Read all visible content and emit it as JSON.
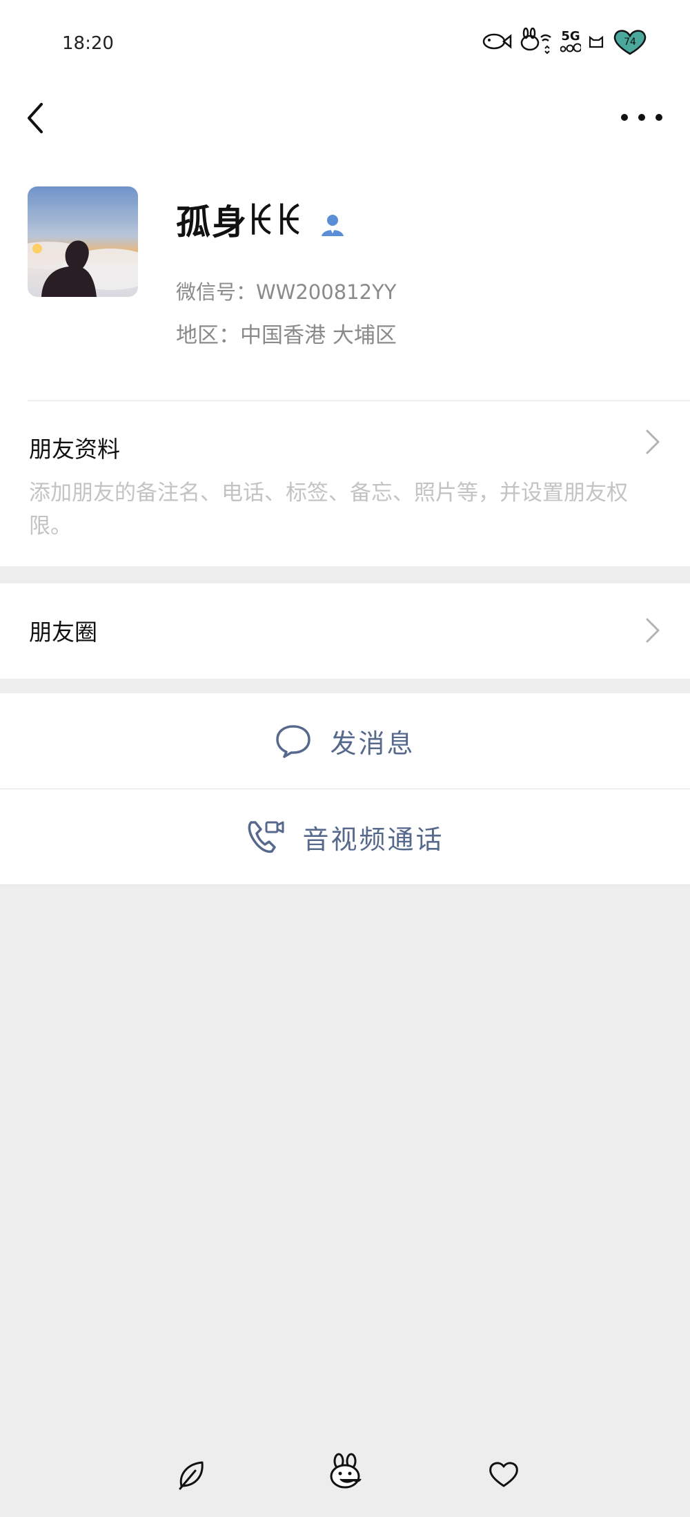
{
  "status_bar": {
    "time": "18:20",
    "network": "5G",
    "battery": "74"
  },
  "header": {
    "back_icon": "chevron-left-icon",
    "more_icon": "more-dots-icon"
  },
  "profile": {
    "nickname": "孤身ꀘꀘ",
    "wechat_id": "微信号：WW200812YY",
    "region": "地区：中国香港 大埔区",
    "badge_icon": "person-icon"
  },
  "rows": {
    "friend_profile_title": "朋友资料",
    "friend_profile_desc": "添加朋友的备注名、电话、标签、备忘、照片等，并设置朋友权限。",
    "moments_title": "朋友圈"
  },
  "actions": {
    "send_message": "发消息",
    "video_call": "音视频通话"
  },
  "bottom_nav": [
    "leaf-icon",
    "bunny-icon",
    "heart-icon"
  ],
  "colors": {
    "accent": "#56698c",
    "badge_blue": "#5a8fd6",
    "background": "#ededed"
  }
}
